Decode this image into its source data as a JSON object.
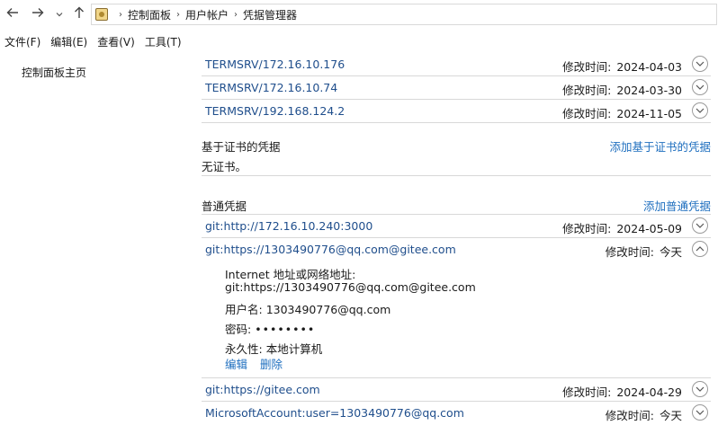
{
  "address_bar": {
    "back_icon": "arrow-left-icon",
    "forward_icon": "arrow-right-icon",
    "recent_icon": "chevron-down-icon",
    "up_icon": "arrow-up-icon",
    "breadcrumbs": [
      "控制面板",
      "用户帐户",
      "凭据管理器"
    ]
  },
  "menu": [
    "文件(F)",
    "编辑(E)",
    "查看(V)",
    "工具(T)"
  ],
  "sidebar": {
    "home_link": "控制面板主页"
  },
  "windows_credentials": [
    {
      "name": "TERMSRV/172.16.10.176",
      "modified_label": "修改时间:",
      "modified": "2024-04-03"
    },
    {
      "name": "TERMSRV/172.16.10.74",
      "modified_label": "修改时间:",
      "modified": "2024-03-30"
    },
    {
      "name": "TERMSRV/192.168.124.2",
      "modified_label": "修改时间:",
      "modified": "2024-11-05"
    }
  ],
  "certificate_section": {
    "title": "基于证书的凭据",
    "add_link": "添加基于证书的凭据",
    "empty_text": "无证书。"
  },
  "generic_section": {
    "title": "普通凭据",
    "add_link": "添加普通凭据",
    "items": [
      {
        "name": "git:http://172.16.10.240:3000",
        "modified_label": "修改时间:",
        "modified": "2024-05-09"
      },
      {
        "name": "git:https://1303490776@qq.com@gitee.com",
        "modified_label": "修改时间:",
        "modified": "今天",
        "expanded": true,
        "details": {
          "address_label": "Internet 地址或网络地址:",
          "address_value": "git:https://1303490776@qq.com@gitee.com",
          "username_label": "用户名:",
          "username_value": "1303490776@qq.com",
          "password_label": "密码:",
          "password_value": "••••••••",
          "persistence_label": "永久性:",
          "persistence_value": "本地计算机",
          "edit_link": "编辑",
          "delete_link": "删除"
        }
      },
      {
        "name": "git:https://gitee.com",
        "modified_label": "修改时间:",
        "modified": "2024-04-29"
      },
      {
        "name": "MicrosoftAccount:user=1303490776@qq.com",
        "modified_label": "修改时间:",
        "modified": "今天"
      }
    ]
  },
  "colors": {
    "link": "#1f4e8c",
    "action_link": "#1f6fbf",
    "divider": "#d8d8d8"
  }
}
